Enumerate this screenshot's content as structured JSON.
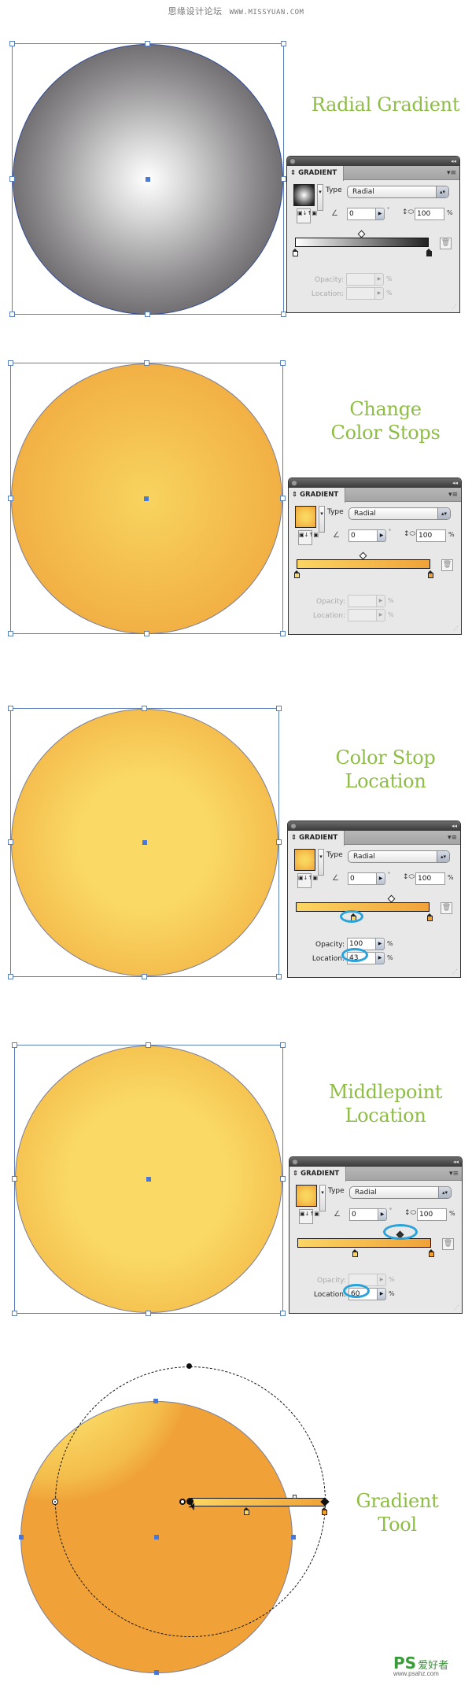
{
  "header": {
    "site_name_cn": "思缘设计论坛",
    "site_url": "WWW.MISSYUAN.COM"
  },
  "sections": [
    {
      "title_lines": [
        "Radial Gradient"
      ],
      "panel": {
        "tab": "GRADIENT",
        "type_label": "Type",
        "type_value": "Radial",
        "angle": "0",
        "degree_sign": "°",
        "aspect_ratio": "100",
        "percent": "%",
        "opacity_label": "Opacity:",
        "opacity_value": "",
        "location_label": "Location:",
        "location_value": "",
        "fields_enabled": false,
        "stops": [
          {
            "location_pct": 0,
            "color": "#ffffff"
          },
          {
            "location_pct": 100,
            "color": "#222222"
          }
        ],
        "midpoint_pct": 50
      }
    },
    {
      "title_lines": [
        "Change",
        "Color Stops"
      ],
      "panel": {
        "tab": "GRADIENT",
        "type_label": "Type",
        "type_value": "Radial",
        "angle": "0",
        "degree_sign": "°",
        "aspect_ratio": "100",
        "percent": "%",
        "opacity_label": "Opacity:",
        "opacity_value": "",
        "location_label": "Location:",
        "location_value": "",
        "fields_enabled": false,
        "stops": [
          {
            "location_pct": 0,
            "color": "#fbd562"
          },
          {
            "location_pct": 100,
            "color": "#f0a238"
          }
        ],
        "midpoint_pct": 50
      }
    },
    {
      "title_lines": [
        "Color Stop",
        "Location"
      ],
      "panel": {
        "tab": "GRADIENT",
        "type_label": "Type",
        "type_value": "Radial",
        "angle": "0",
        "degree_sign": "°",
        "aspect_ratio": "100",
        "percent": "%",
        "opacity_label": "Opacity:",
        "opacity_value": "100",
        "location_label": "Location:",
        "location_value": "43",
        "fields_enabled": true,
        "stops": [
          {
            "location_pct": 43,
            "color": "#fbd562"
          },
          {
            "location_pct": 100,
            "color": "#f0a238"
          }
        ],
        "midpoint_pct": 71
      }
    },
    {
      "title_lines": [
        "Middlepoint",
        "Location"
      ],
      "panel": {
        "tab": "GRADIENT",
        "type_label": "Type",
        "type_value": "Radial",
        "angle": "0",
        "degree_sign": "°",
        "aspect_ratio": "100",
        "percent": "%",
        "opacity_label": "Opacity:",
        "opacity_value": "",
        "location_label": "Location:",
        "location_value": "60",
        "fields_enabled": false,
        "location_enabled": true,
        "stops": [
          {
            "location_pct": 43,
            "color": "#fbd562"
          },
          {
            "location_pct": 100,
            "color": "#f0a238"
          }
        ],
        "midpoint_pct": 60
      }
    },
    {
      "title_lines": [
        "Gradient",
        "Tool"
      ]
    }
  ],
  "icons": {
    "collapse": "◂◂",
    "panel_menu": "▾≡",
    "tab_toggle": "⇕",
    "dropdown": "▾",
    "select_arrows": "▴▾",
    "reverse": "▣↓↑▣",
    "angle": "∠",
    "aspect": "↕⬭",
    "step": "▶",
    "trash": "🗑",
    "grip": "⋰",
    "cursor": "➤"
  },
  "watermark": {
    "brand": "PS",
    "brand_cn": "爱好者",
    "url": "www.psahz.com"
  },
  "colors": {
    "title_green": "#8ebd44",
    "selection_blue": "#5b7fb8",
    "highlight_ring": "#29a3da",
    "orange_light": "#fad965",
    "orange_dark": "#f0a238"
  }
}
